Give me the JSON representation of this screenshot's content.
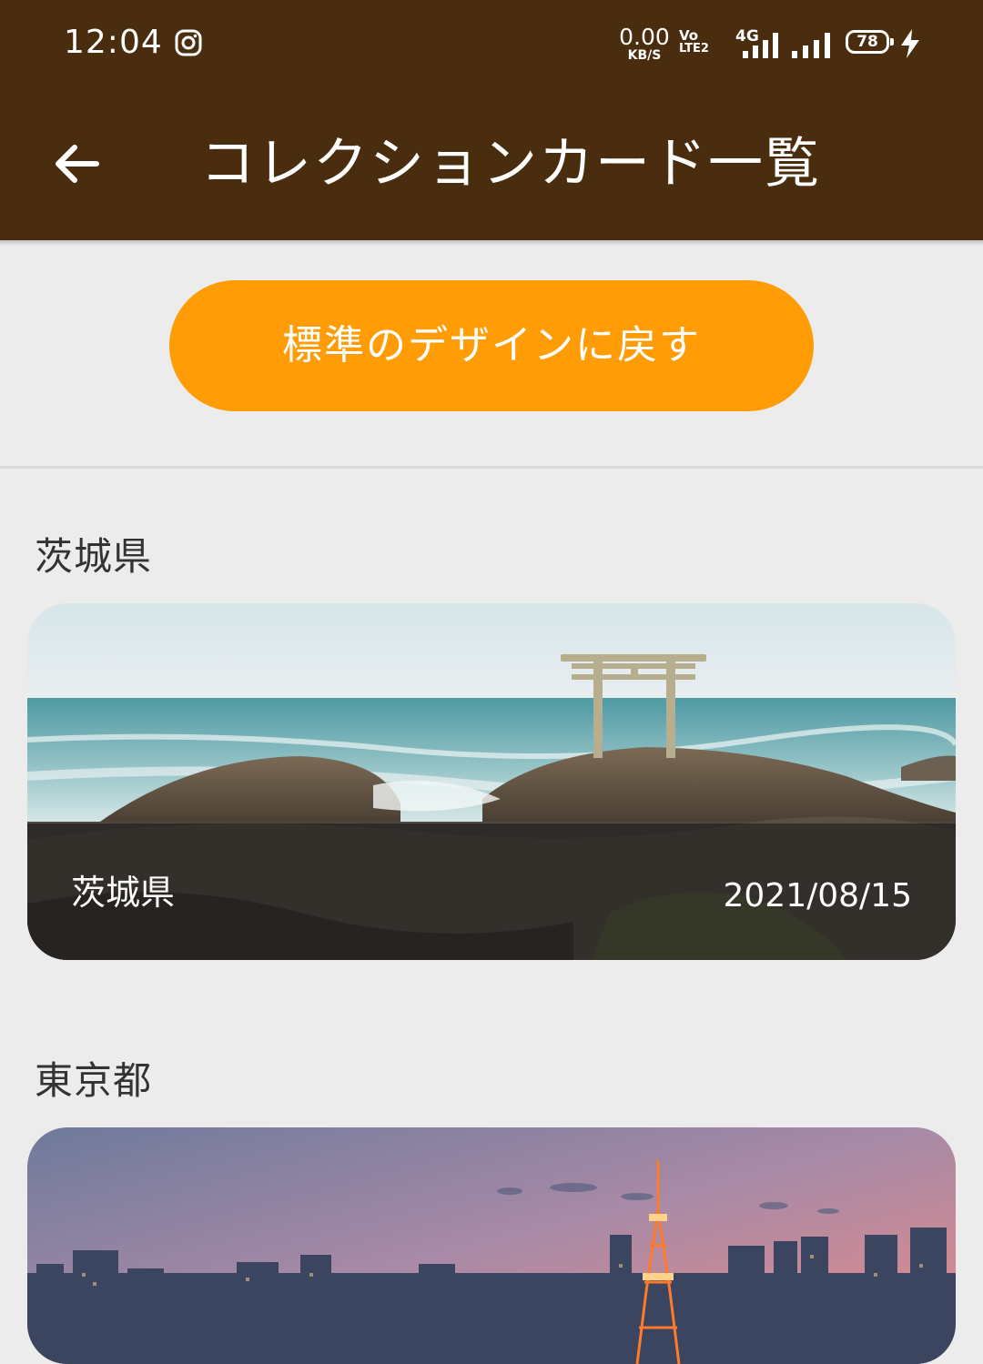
{
  "status_bar": {
    "time": "12:04",
    "net_speed_value": "0.00",
    "net_speed_unit": "KB/S",
    "volte_line1": "Vo",
    "volte_line2": "LTE2",
    "network_type": "4G",
    "battery_percent": "78",
    "icons": [
      "instagram-icon",
      "signal-icon",
      "battery-icon",
      "charging-bolt-icon"
    ]
  },
  "app_bar": {
    "title": "コレクションカード一覧",
    "back_icon": "arrow-left-icon"
  },
  "reset_button": {
    "label": "標準のデザインに戻す"
  },
  "sections": [
    {
      "heading": "茨城県",
      "card": {
        "prefecture": "茨城県",
        "date": "2021/08/15"
      }
    },
    {
      "heading": "東京都",
      "card": {
        "prefecture": "",
        "date": ""
      }
    }
  ],
  "colors": {
    "header_bg": "#4a2c0e",
    "accent_orange": "#ff9c06",
    "page_bg": "#ececec"
  }
}
